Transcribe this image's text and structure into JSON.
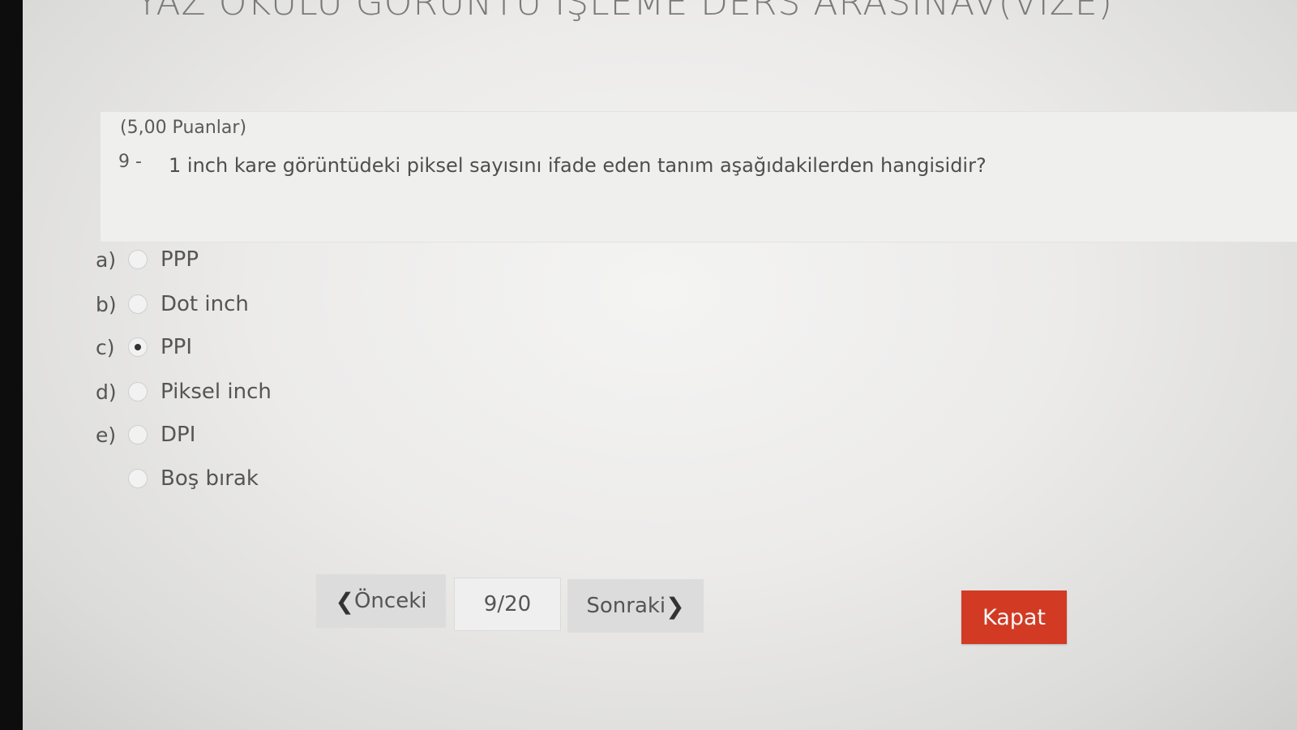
{
  "exam": {
    "title": "YAZ OKULU GÖRÜNTÜ İŞLEME DERS ARASINAV(VİZE)"
  },
  "question": {
    "points": "(5,00 Puanlar)",
    "number": "9 -",
    "text": "1 inch kare görüntüdeki piksel sayısını ifade eden tanım aşağıdakilerden hangisidir?"
  },
  "options": [
    {
      "letter": "a)",
      "label": "PPP",
      "selected": false
    },
    {
      "letter": "b)",
      "label": "Dot inch",
      "selected": false
    },
    {
      "letter": "c)",
      "label": "PPI",
      "selected": true
    },
    {
      "letter": "d)",
      "label": "Piksel inch",
      "selected": false
    },
    {
      "letter": "e)",
      "label": "DPI",
      "selected": false
    },
    {
      "letter": "",
      "label": "Boş bırak",
      "selected": false
    }
  ],
  "navigation": {
    "previous_label": "Önceki",
    "page_indicator": "9/20",
    "next_label": "Sonraki",
    "close_label": "Kapat"
  },
  "colors": {
    "close_button": "#d23a24",
    "nav_button": "#dcdcdc"
  }
}
